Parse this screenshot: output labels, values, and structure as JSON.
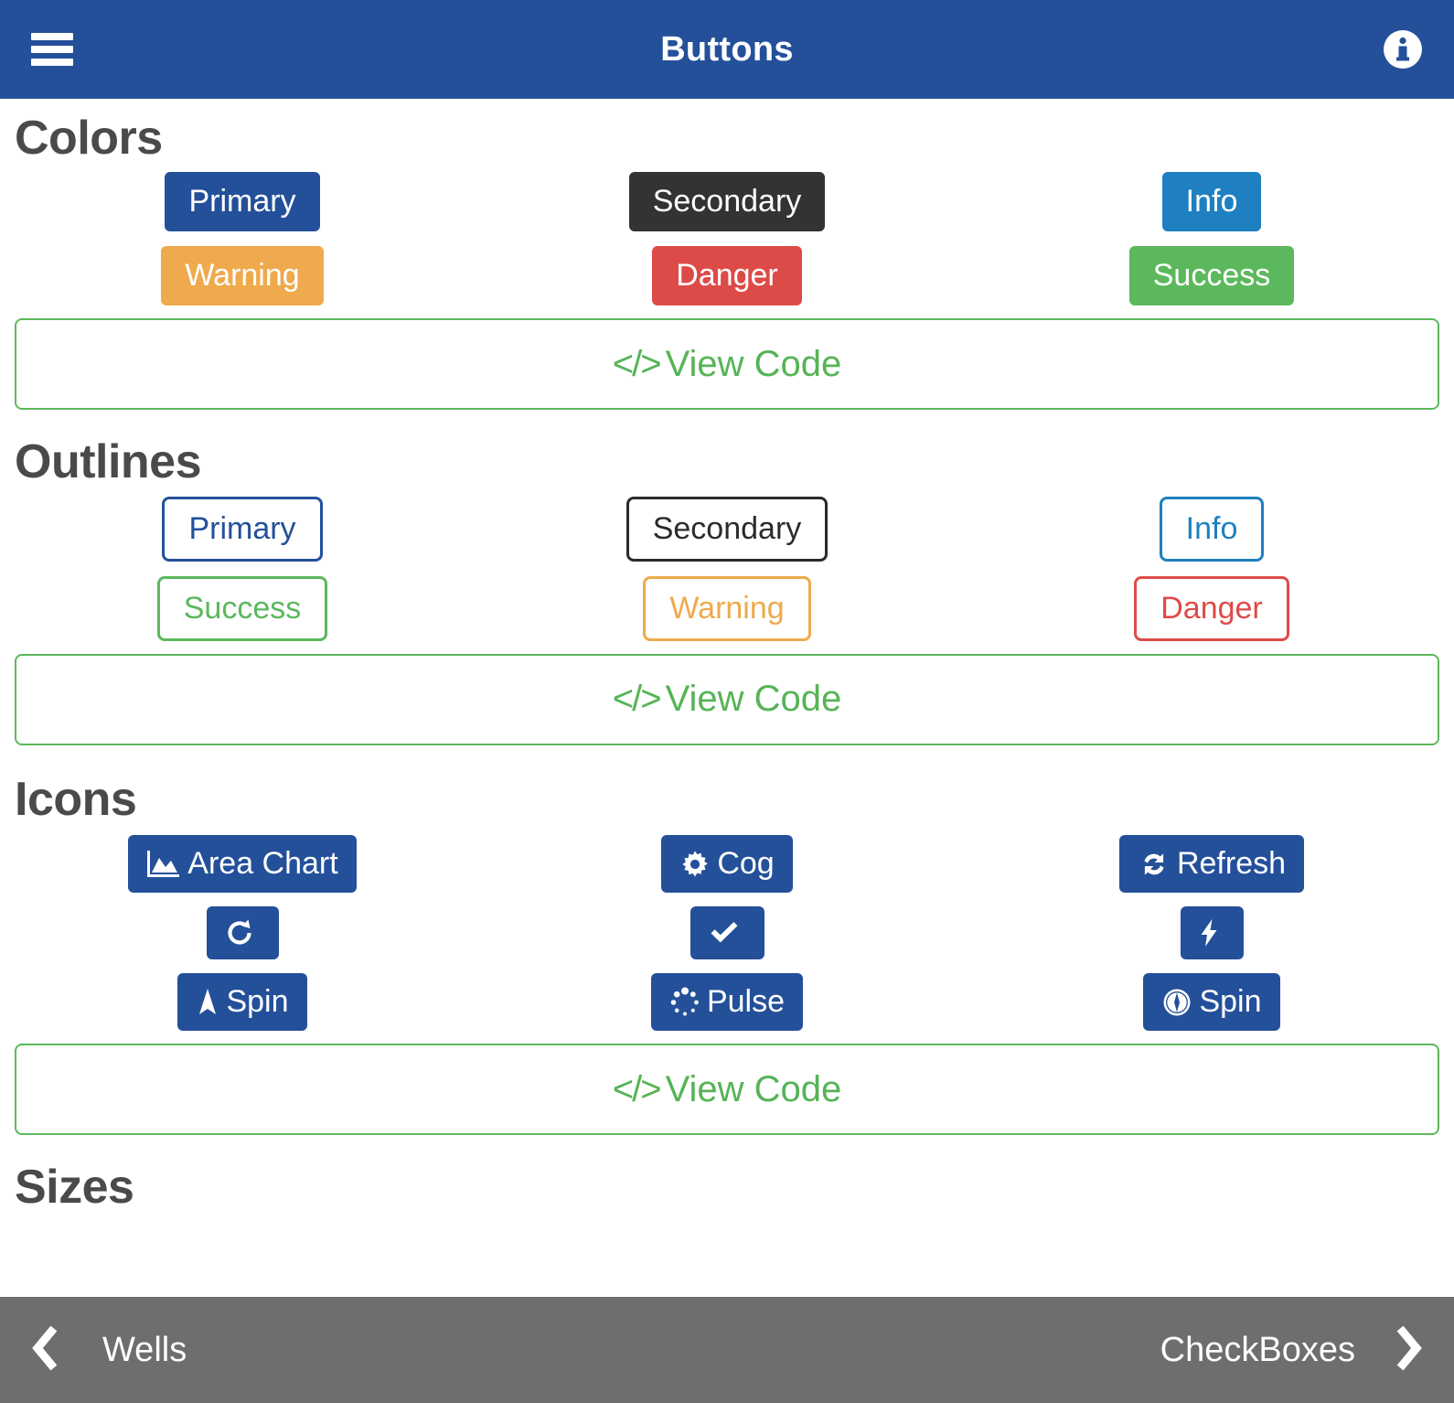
{
  "header": {
    "title": "Buttons",
    "menu_icon": "hamburger-menu-icon",
    "info_icon": "info-circle-icon"
  },
  "sections": [
    {
      "title": "Colors",
      "rows": [
        [
          {
            "label": "Primary",
            "variant": "primary"
          },
          {
            "label": "Secondary",
            "variant": "secondary"
          },
          {
            "label": "Info",
            "variant": "info"
          }
        ],
        [
          {
            "label": "Warning",
            "variant": "warning"
          },
          {
            "label": "Danger",
            "variant": "danger"
          },
          {
            "label": "Success",
            "variant": "success"
          }
        ]
      ],
      "view_code": "View Code"
    },
    {
      "title": "Outlines",
      "rows": [
        [
          {
            "label": "Primary",
            "variant": "primary"
          },
          {
            "label": "Secondary",
            "variant": "secondary"
          },
          {
            "label": "Info",
            "variant": "info"
          }
        ],
        [
          {
            "label": "Success",
            "variant": "success"
          },
          {
            "label": "Warning",
            "variant": "warning"
          },
          {
            "label": "Danger",
            "variant": "danger"
          }
        ]
      ],
      "view_code": "View Code"
    },
    {
      "title": "Icons",
      "rows": [
        [
          {
            "label": "Area Chart",
            "icon": "area-chart-icon"
          },
          {
            "label": "Cog",
            "icon": "cog-icon"
          },
          {
            "label": "Refresh",
            "icon": "refresh-icon"
          }
        ],
        [
          {
            "label": "",
            "icon": "redo-icon"
          },
          {
            "label": "",
            "icon": "check-icon"
          },
          {
            "label": "",
            "icon": "bolt-icon"
          }
        ],
        [
          {
            "label": "Spin",
            "icon": "location-arrow-icon"
          },
          {
            "label": "Pulse",
            "icon": "spinner-dots-icon"
          },
          {
            "label": "Spin",
            "icon": "compass-icon"
          }
        ]
      ],
      "view_code": "View Code"
    },
    {
      "title": "Sizes"
    }
  ],
  "bottom_nav": {
    "prev_label": "Wells",
    "next_label": "CheckBoxes",
    "prev_icon": "chevron-left-icon",
    "next_icon": "chevron-right-icon"
  },
  "colors": {
    "header_blue": "#24509a",
    "primary": "#24509a",
    "secondary": "#333333",
    "info": "#1e80c0",
    "warning": "#eeaa4d",
    "danger": "#dd4b48",
    "success": "#5cb85c",
    "view_code_green": "#56b456",
    "heading_gray": "#4a4a48",
    "nav_gray": "#5a5a5a"
  }
}
